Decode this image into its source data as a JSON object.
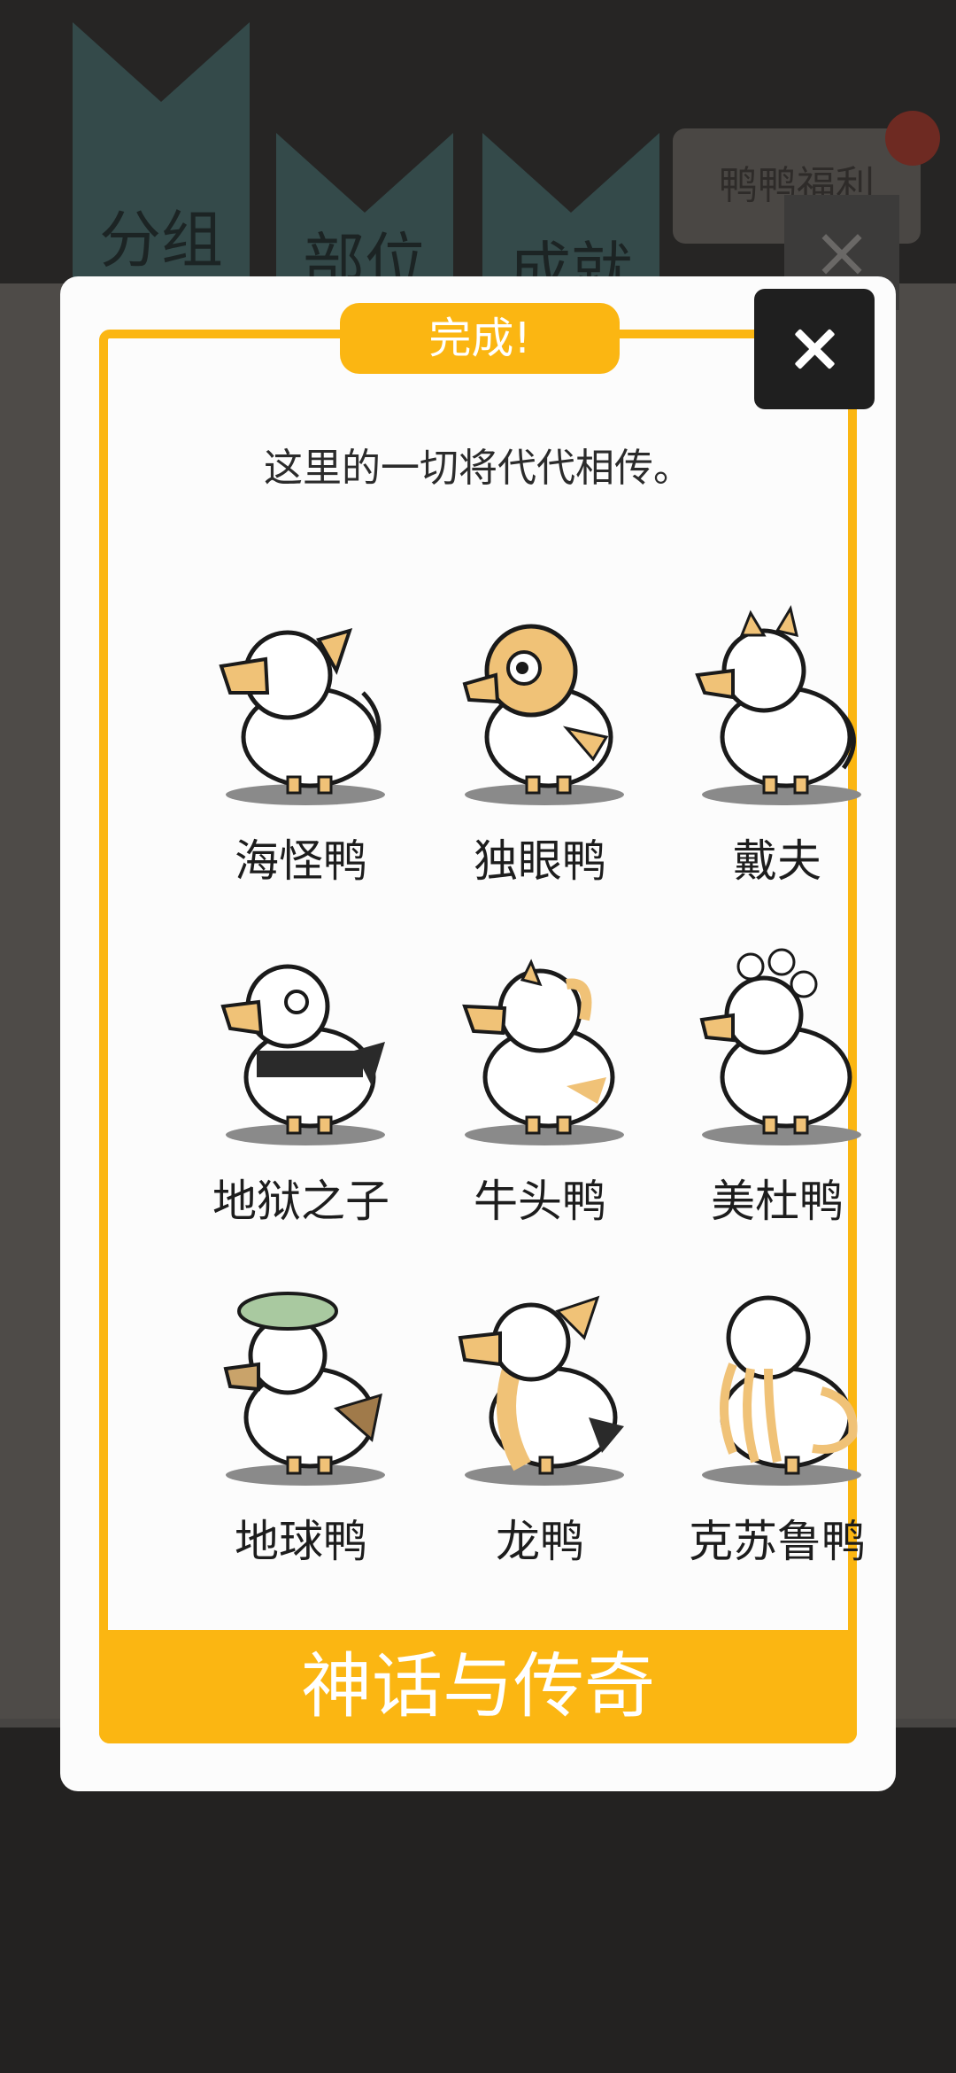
{
  "background": {
    "tabs": [
      "分组",
      "部位",
      "成就"
    ],
    "promo_button": "鸭鸭福利",
    "close_label": "×"
  },
  "modal": {
    "badge": "完成!",
    "subtitle": "这里的一切将代代相传。",
    "collection_name": "神话与传奇",
    "ducks": [
      {
        "name": "海怪鸭",
        "accent": "#f0c277"
      },
      {
        "name": "独眼鸭",
        "accent": "#f0c277"
      },
      {
        "name": "戴夫",
        "accent": "#f0c277"
      },
      {
        "name": "地狱之子",
        "accent": "#2a2a2a"
      },
      {
        "name": "牛头鸭",
        "accent": "#f0c277"
      },
      {
        "name": "美杜鸭",
        "accent": "#f0c277"
      },
      {
        "name": "地球鸭",
        "accent": "#a9c9a0"
      },
      {
        "name": "龙鸭",
        "accent": "#f0c277"
      },
      {
        "name": "克苏鲁鸭",
        "accent": "#f0c277"
      }
    ]
  },
  "colors": {
    "accent": "#fbb612",
    "modal_bg": "#fcfcfc",
    "overlay": "#2b2a29"
  }
}
